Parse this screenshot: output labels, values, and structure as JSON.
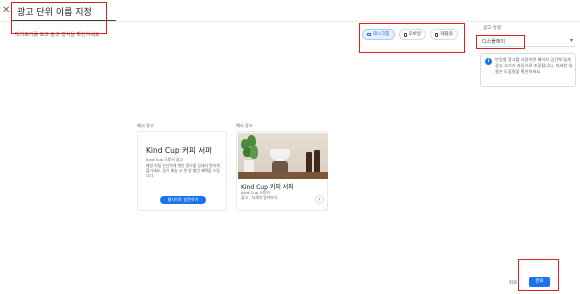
{
  "header": {
    "close_icon": "close-icon",
    "title": "광고 단위 이름 지정",
    "subtitle": "미리보기를 보고 광고 형식을 확인하세요"
  },
  "device_toggle": {
    "items": [
      {
        "label": "데스크톱",
        "icon": "desktop-icon",
        "active": true
      },
      {
        "label": "모바일",
        "icon": "mobile-icon",
        "active": false
      },
      {
        "label": "태블릿",
        "icon": "tablet-icon",
        "active": false
      }
    ]
  },
  "side_panel": {
    "label": "광고 유형",
    "select_value": "디스플레이",
    "select_icon": "chevron-down-icon",
    "info_icon": "info-icon",
    "info_text": "반응형 광고를 사용하면 페이지 공간에 맞게 광고 크기가 자동으로 조정됩니다. 자세한 내용은 도움말을 확인하세요."
  },
  "preview": {
    "label_left": "예시 광고",
    "label_right": "예시 광고",
    "ad_title": "Kind Cup 커피 서퍼",
    "ad_meta": "Kind Cup 스토어 광고",
    "ad_desc": "매일 아침 신선하게 볶은 원두를 집에서 편하게 즐기세요. 정기 배송 시 첫 달 할인 혜택을 드립니다.",
    "ad_button": "웹사이트 방문하기",
    "photo_title": "Kind Cup 커피 서퍼",
    "photo_meta": "Kind Cup 스토어",
    "photo_meta2": "광고 · 자세히 알아보기",
    "next_icon": "chevron-right-icon"
  },
  "footer": {
    "back_label": "뒤로",
    "done_label": "완료"
  },
  "colors": {
    "accent": "#1a73e8",
    "highlight_border": "#e0201c"
  }
}
